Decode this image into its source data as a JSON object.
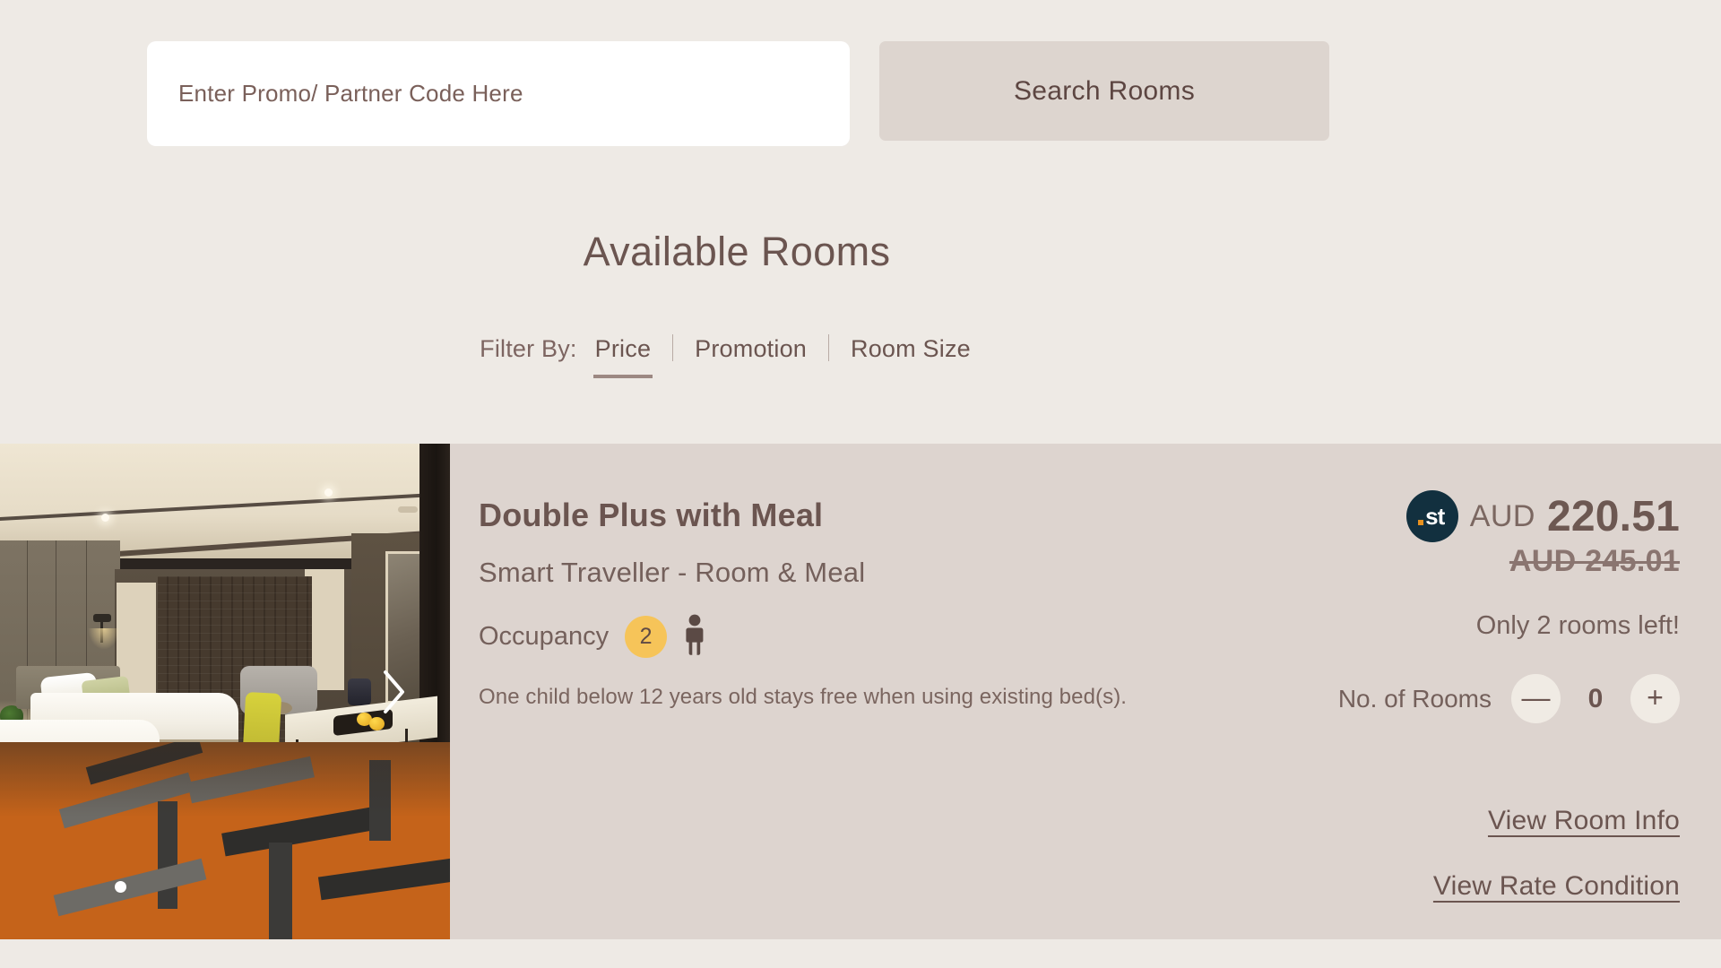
{
  "search": {
    "promo_placeholder": "Enter Promo/ Partner Code Here",
    "promo_value": "",
    "search_button": "Search Rooms"
  },
  "heading": {
    "title": "Available Rooms"
  },
  "filter": {
    "label": "Filter By:",
    "items": [
      {
        "label": "Price",
        "active": true
      },
      {
        "label": "Promotion",
        "active": false
      },
      {
        "label": "Room Size",
        "active": false
      }
    ]
  },
  "room": {
    "name": "Double Plus with Meal",
    "rate_name": "Smart Traveller - Room & Meal",
    "occupancy_label": "Occupancy",
    "occupancy_count": "2",
    "child_note": "One child below 12 years old stays free when using existing bed(s).",
    "price": {
      "badge_text": "st",
      "currency": "AUD",
      "amount": "220.51",
      "struck_price": "AUD 245.01"
    },
    "rooms_left": "Only 2 rooms left!",
    "stepper": {
      "label": "No. of Rooms",
      "decrement": "—",
      "value": "0",
      "increment": "+"
    },
    "links": [
      {
        "label": "View Room Info"
      },
      {
        "label": "View Rate Condition"
      }
    ],
    "carousel": {
      "slide_count": 1,
      "current_slide": 1
    }
  },
  "colors": {
    "page_background": "#eeeae5",
    "card_background": "#ddd4cf",
    "button_background": "#ddd5cf",
    "text_primary": "#6b5550",
    "occupancy_badge": "#f6c459",
    "st_badge": "#12303f",
    "st_dot": "#e8921f",
    "filter_underline": "#9c8882"
  }
}
